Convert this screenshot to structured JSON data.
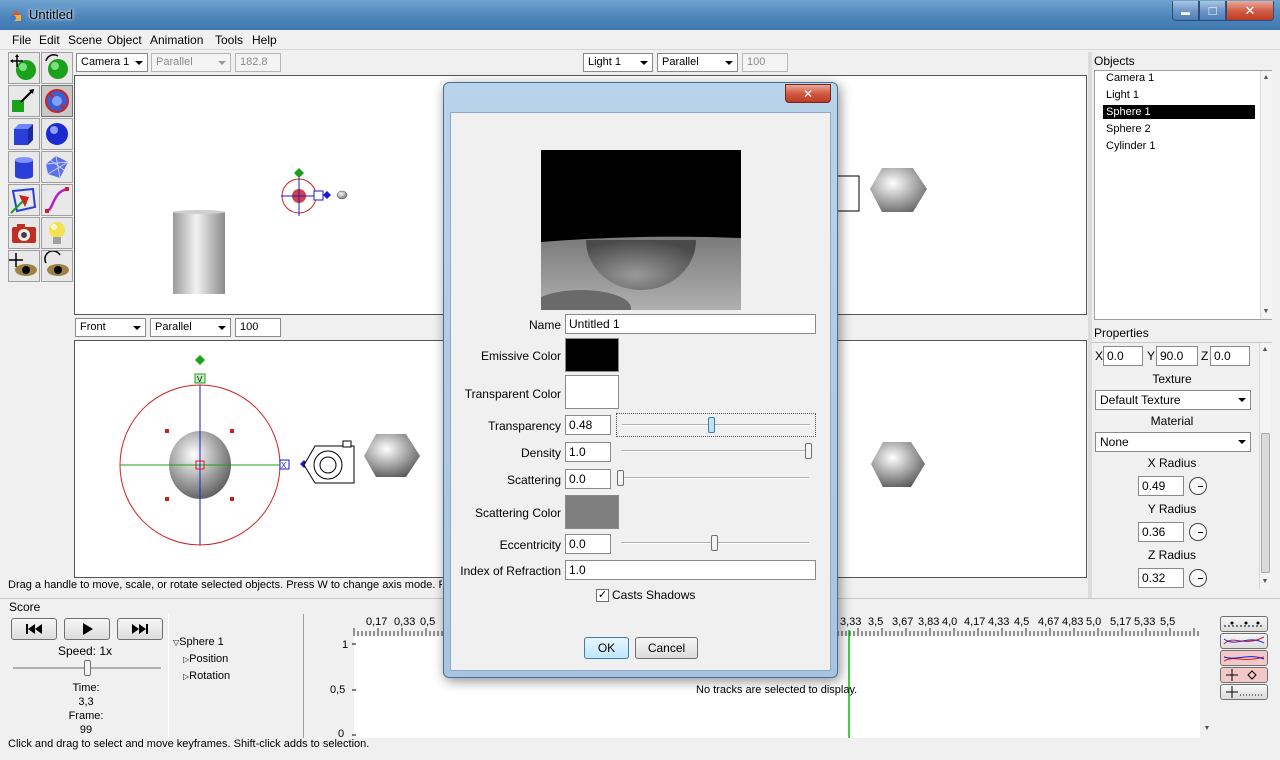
{
  "window": {
    "title": "Untitled",
    "minimize_glyph": "▬",
    "maximize_glyph": "□",
    "close_glyph": "✕"
  },
  "menu": [
    "File",
    "Edit",
    "Scene",
    "Object",
    "Animation",
    "Tools",
    "Help"
  ],
  "tools": [
    "move-tool-icon",
    "rotate-tool-icon",
    "skew-tool-icon",
    "scale-tool-icon",
    "cube-tool-icon",
    "sphere-tool-icon",
    "cylinder-tool-icon",
    "mesh-tool-icon",
    "polygon-tool-icon",
    "curve-tool-icon",
    "camera-tool-icon",
    "light-tool-icon",
    "pan-view-icon",
    "rotate-view-icon"
  ],
  "viewports": {
    "top_left": {
      "camera": "Camera 1",
      "projection": "Parallel",
      "scale": "182.8"
    },
    "top_right": {
      "camera": "Light 1",
      "projection": "Parallel",
      "scale": "100"
    },
    "bottom_left": {
      "camera": "Front",
      "projection": "Parallel",
      "scale": "100"
    }
  },
  "handle_labels": {
    "v": "V",
    "x": "X"
  },
  "status_top": "Drag a handle to move, scale, or rotate selected objects.  Press W to change axis mode.  P",
  "objects_panel": {
    "title": "Objects",
    "items": [
      "Camera 1",
      "Light 1",
      "Sphere 1",
      "Sphere 2",
      "Cylinder 1"
    ],
    "selected": "Sphere 1"
  },
  "properties_panel": {
    "title": "Properties",
    "x_label": "X",
    "x_value": "0.0",
    "y_label": "Y",
    "y_value": "90.0",
    "z_label": "Z",
    "z_value": "0.0",
    "texture_label": "Texture",
    "texture_value": "Default Texture",
    "material_label": "Material",
    "material_value": "None",
    "xradius_label": "X Radius",
    "xradius_value": "0.49",
    "yradius_label": "Y Radius",
    "yradius_value": "0.36",
    "zradius_label": "Z Radius",
    "zradius_value": "0.32"
  },
  "score": {
    "title": "Score",
    "speed_label": "Speed: 1x",
    "time_label": "Time:",
    "time_value": "3,3",
    "frame_label": "Frame:",
    "frame_value": "99",
    "tree": {
      "root": "Sphere 1",
      "children": [
        "Position",
        "Rotation"
      ]
    },
    "ruler": [
      "0,17",
      "0,33",
      "0,5",
      "3,33",
      "3,5",
      "3,67",
      "3,83",
      "4,0",
      "4,17",
      "4,33",
      "4,5",
      "4,67",
      "4,83",
      "5,0",
      "5,17",
      "5,33",
      "5,5"
    ],
    "y_axis": [
      "1",
      "0,5",
      "0"
    ],
    "empty_message": "No tracks are selected to display.",
    "status": "Click and drag to select and move keyframes.  Shift-click adds to selection."
  },
  "material_dialog": {
    "name_label": "Name",
    "name_value": "Untitled 1",
    "emissive_label": "Emissive Color",
    "emissive_color": "#000000",
    "transparent_label": "Transparent Color",
    "transparent_color": "#ffffff",
    "transparency_label": "Transparency",
    "transparency_value": "0.48",
    "transparency_fraction": 0.48,
    "density_label": "Density",
    "density_value": "1.0",
    "density_fraction": 1.0,
    "scattering_label": "Scattering",
    "scattering_value": "0.0",
    "scattering_fraction": 0.0,
    "scattering_color_label": "Scattering Color",
    "scattering_color": "#7f7f7f",
    "eccentricity_label": "Eccentricity",
    "eccentricity_value": "0.0",
    "eccentricity_fraction": 0.5,
    "ior_label": "Index of Refraction",
    "ior_value": "1.0",
    "casts_shadows_label": "Casts Shadows",
    "casts_shadows": true,
    "ok_label": "OK",
    "cancel_label": "Cancel",
    "close_glyph": "✕"
  },
  "colors": {
    "accent_title": "#4d86bb",
    "selection": "#000000",
    "timeline_marker": "#00c000"
  }
}
